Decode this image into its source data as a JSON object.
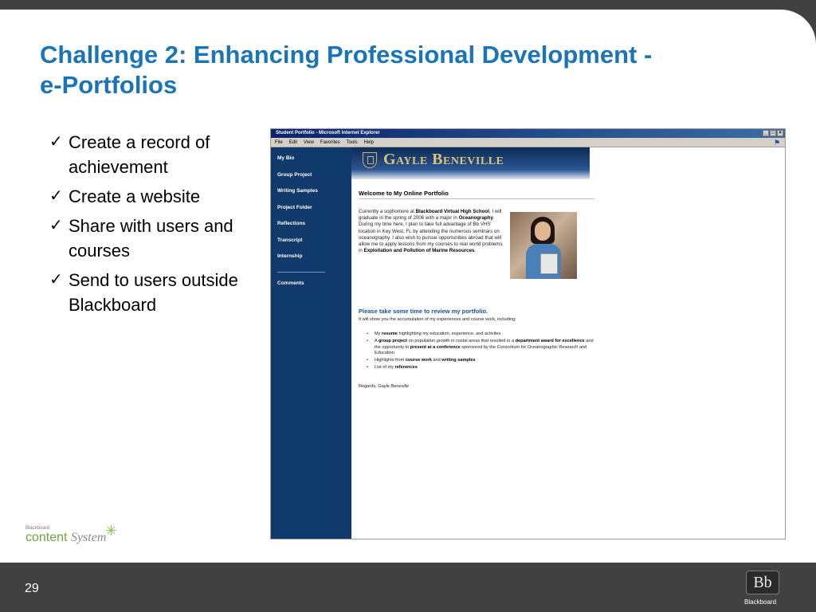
{
  "slide": {
    "title_line1": "Challenge 2: Enhancing Professional Development -",
    "title_line2": "e-Portfolios",
    "page_number": "29",
    "bullets": [
      "Create a record of achievement",
      "Create a website",
      "Share with users and courses",
      "Send to users outside Blackboard"
    ]
  },
  "browser": {
    "window_title": "Student Portfolio - Microsoft Internet Explorer",
    "menu": [
      "File",
      "Edit",
      "View",
      "Favorites",
      "Tools",
      "Help"
    ]
  },
  "portfolio": {
    "banner_name": "Gayle Beneville",
    "sidebar": [
      "My Bio",
      "Group Project",
      "Writing Samples",
      "Project Folder",
      "Reflections",
      "Transcript",
      "Internship"
    ],
    "sidebar_comments": "Comments",
    "welcome": "Welcome to My Online Portfolio",
    "intro": {
      "p1": "Currently a sophomore at",
      "b1": "Blackboard Virtual High School",
      "p2": ", I will graduate in the spring of 2006 with a major in",
      "b2": "Oceanography",
      "p3": ". During my time here, I plan to take full advantage of Bb VHS' location in Key West, FL by attending the numerous seminars on oceanography. I also wish to pursue opportunities abroad that will allow me to apply lessons from my courses to real world problems in",
      "b3": "Exploitation and Pollution of Marine Resources",
      "p4": "."
    },
    "cta": "Please take some time to review my portfolio.",
    "cta_sub": "It will show you the accumulation of my experiences and course work, including:",
    "items": [
      {
        "t1": "My ",
        "b1": "resume",
        "t2": " highlighting my education, experience, and activites"
      },
      {
        "t1": "A ",
        "b1": "group project",
        "t2": " on population growth in costal areas that resulted in a ",
        "b2": "department award for excellence",
        "t3": " and the opportunity to ",
        "b3": "present at a conference",
        "t4": " sponsored by the Consortium for Oceanographic Research and Education"
      },
      {
        "t1": "Highlights from ",
        "b1": "course work",
        "t2": " and ",
        "b2": "writing samples"
      },
      {
        "t1": "List of my ",
        "b1": "references"
      }
    ],
    "regards": "Regards,",
    "signature": "Gayle Beneville"
  },
  "footer": {
    "cs_small": "Blackboard",
    "cs_content": "content",
    "cs_system": "System",
    "bb_logo": "Bb",
    "bb_caption": "Blackboard"
  },
  "colors": {
    "title": "#1a75b8",
    "frame": "#414141",
    "sidebar": "#0f3a6b"
  }
}
